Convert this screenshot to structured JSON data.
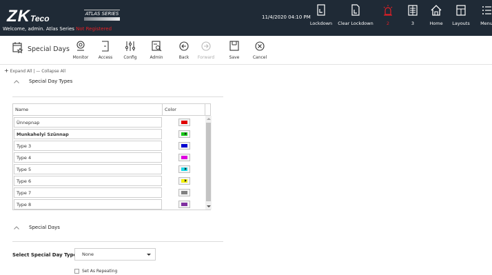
{
  "header": {
    "logo": "ZK",
    "logo_sub": "Teco",
    "atlas_badge": "ATLAS SERIES",
    "welcome": "Welcome, admin.  Atlas Series",
    "not_registered": "Not Registered",
    "datetime": "11/4/2020 04:10 PM",
    "buttons": [
      {
        "label": "Lockdown",
        "icon": "lockdown-icon"
      },
      {
        "label": "Clear Lockdown",
        "icon": "clear-lockdown-icon"
      },
      {
        "label": "2",
        "icon": "alarm-icon",
        "color": "#e41f25"
      },
      {
        "label": "3",
        "icon": "events-icon"
      },
      {
        "label": "Home",
        "icon": "home-icon"
      },
      {
        "label": "Layouts",
        "icon": "layouts-icon"
      },
      {
        "label": "Menu",
        "icon": "menu-icon"
      }
    ]
  },
  "toolbar": {
    "title": "Special Days",
    "buttons": [
      {
        "label": "Monitor"
      },
      {
        "label": "Access"
      },
      {
        "label": "Config"
      },
      {
        "label": "Admin"
      },
      {
        "label": "Back"
      },
      {
        "label": "Forward",
        "disabled": true
      },
      {
        "label": "Save"
      },
      {
        "label": "Cancel"
      }
    ]
  },
  "content": {
    "expand_all": "Expand All",
    "collapse_all": "Collapse All",
    "section1_title": "Special Day Types",
    "section2_title": "Special Days",
    "grid": {
      "col_name": "Name",
      "col_color": "Color",
      "rows": [
        {
          "name": "Ünnepnap",
          "color": "#e00000",
          "bold": false,
          "dropdown": false
        },
        {
          "name": "Munkahelyi Szünnap",
          "color": "#18c818",
          "bold": true,
          "dropdown": true
        },
        {
          "name": "Type 3",
          "color": "#0000d0",
          "bold": false,
          "dropdown": false
        },
        {
          "name": "Type 4",
          "color": "#e000e0",
          "bold": false,
          "dropdown": false
        },
        {
          "name": "Type 5",
          "color": "#18d8e8",
          "bold": false,
          "dropdown": true
        },
        {
          "name": "Type 6",
          "color": "#f0f000",
          "bold": false,
          "dropdown": true
        },
        {
          "name": "Type 7",
          "color": "#808080",
          "bold": false,
          "dropdown": false
        },
        {
          "name": "Type 8",
          "color": "#8030a0",
          "bold": false,
          "dropdown": false
        }
      ]
    },
    "select_label": "Select Special Day Type",
    "select_value": "None",
    "repeat_label": "Set As Repeating"
  }
}
